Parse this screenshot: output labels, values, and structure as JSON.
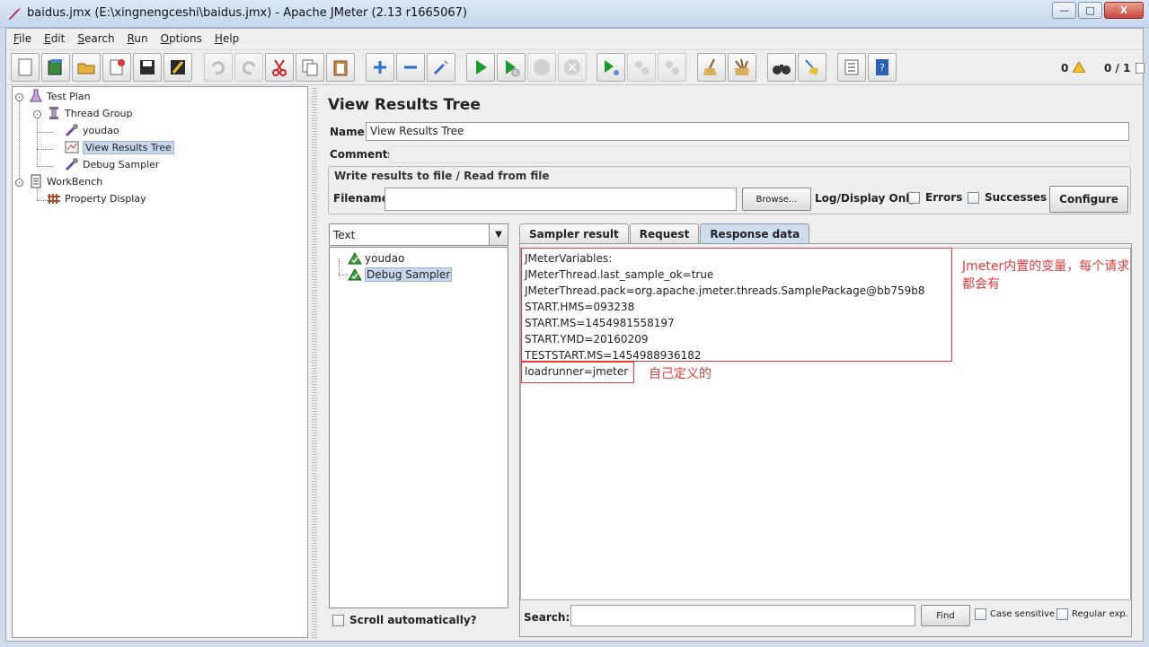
{
  "window": {
    "title": "baidus.jmx (E:\\xingnengceshi\\baidus.jmx) - Apache JMeter (2.13 r1665067)",
    "minimize": "—",
    "maximize": "□",
    "close": "X"
  },
  "menu": [
    "File",
    "Edit",
    "Search",
    "Run",
    "Options",
    "Help"
  ],
  "toolbar": {
    "error_count": "0",
    "threads": "0 / 1"
  },
  "tree": {
    "test_plan": "Test Plan",
    "thread_group": "Thread Group",
    "youdao": "youdao",
    "view_results_tree": "View Results Tree",
    "debug_sampler": "Debug Sampler",
    "workbench": "WorkBench",
    "property_display": "Property Display"
  },
  "panel": {
    "title": "View Results Tree",
    "name_label": "Name:",
    "name_value": "View Results Tree",
    "comments_label": "Comments:",
    "file_legend": "Write results to file / Read from file",
    "filename_label": "Filename",
    "browse": "Browse...",
    "log_display_only": "Log/Display Only:",
    "errors": "Errors",
    "successes": "Successes",
    "configure": "Configure"
  },
  "results": {
    "renderer": "Text",
    "items": [
      "youdao",
      "Debug Sampler"
    ],
    "scroll_auto": "Scroll automatically?"
  },
  "tabs": [
    "Sampler result",
    "Request",
    "Response data"
  ],
  "response": {
    "lines": [
      "JMeterVariables:",
      "JMeterThread.last_sample_ok=true",
      "JMeterThread.pack=org.apache.jmeter.threads.SamplePackage@bb759b8",
      "START.HMS=093238",
      "START.MS=1454981558197",
      "START.YMD=20160209",
      "TESTSTART.MS=1454988936182",
      "loadrunner=jmeter"
    ],
    "annotation_builtin": "Jmeter内置的变量，每个请求都会有",
    "annotation_custom": "自己定义的"
  },
  "search": {
    "label": "Search:",
    "find": "Find",
    "case_sensitive": "Case sensitive",
    "regular_exp": "Regular exp."
  }
}
